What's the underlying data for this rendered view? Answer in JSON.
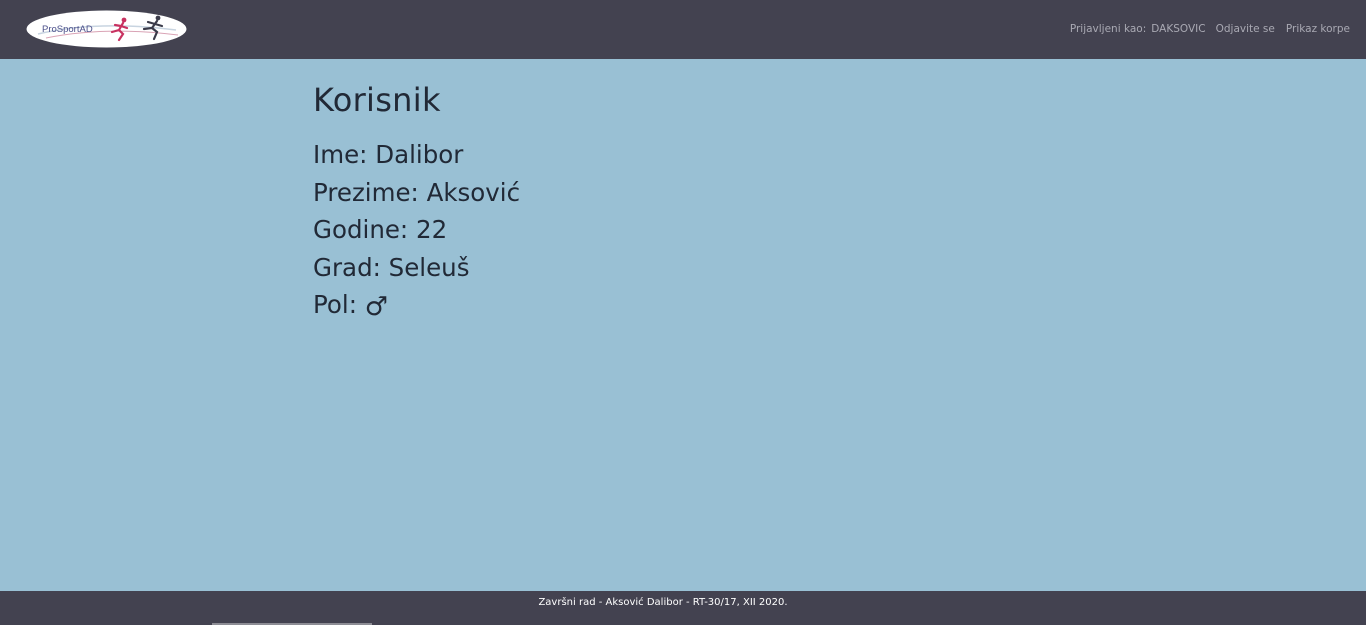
{
  "header": {
    "logo_text": "ProSportAD",
    "logged_in_label": "Prijavljeni kao:",
    "username": "DAKSOVIC",
    "logout_label": "Odjavite se",
    "cart_label": "Prikaz korpe"
  },
  "main": {
    "title": "Korisnik",
    "details": [
      "Ime: Dalibor",
      "Prezime: Aksović",
      "Godine: 22",
      "Grad: Seleuš"
    ],
    "gender_label": "Pol:",
    "gender_icon": "♂"
  },
  "footer": {
    "text": "Završni rad - Aksović Dalibor - RT-30/17, XII 2020."
  },
  "colors": {
    "navbar": "#434250",
    "page_background": "#99c0d4",
    "username_link": "#8f93ff"
  }
}
